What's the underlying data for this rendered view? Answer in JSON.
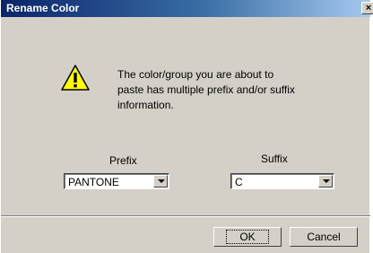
{
  "window": {
    "title": "Rename Color",
    "close_glyph": "×"
  },
  "message": "The color/group you are about to paste has multiple prefix and/or suffix information.",
  "icons": {
    "warning": "warning-icon"
  },
  "prefix": {
    "label": "Prefix",
    "value": "PANTONE"
  },
  "suffix": {
    "label": "Suffix",
    "value": "C"
  },
  "buttons": {
    "ok": "OK",
    "cancel": "Cancel"
  },
  "colors": {
    "title_gradient_start": "#0a246a",
    "title_gradient_end": "#a6caf0",
    "dialog_bg": "#d4d0c8",
    "warning_fill": "#ffff00"
  }
}
